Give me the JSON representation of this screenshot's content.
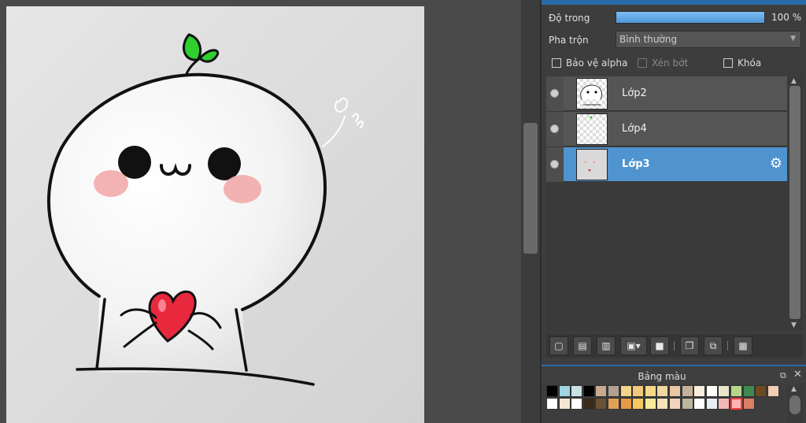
{
  "layer_props": {
    "opacity_label": "Độ trong",
    "opacity_value": "100 %",
    "opacity_level": 1.0,
    "blend_label": "Pha trộn",
    "blend_value": "Bình thường",
    "protect_alpha": "Bảo vệ alpha",
    "clipping": "Xén bớt",
    "lock": "Khóa"
  },
  "layers": [
    {
      "name": "Lớp2",
      "visible": true,
      "active": false
    },
    {
      "name": "Lớp4",
      "visible": true,
      "active": false
    },
    {
      "name": "Lớp3",
      "visible": true,
      "active": true
    }
  ],
  "palette": {
    "title": "Bảng màu",
    "selected_index": 18,
    "colors_row1": [
      "#000000",
      "#9fd3e0",
      "#c9e2e8",
      "#000000",
      "#c8ab8f",
      "#b0a190",
      "#f4d38a",
      "#f2c977",
      "#f5d888",
      "#f0d6a0",
      "#e9c6a4",
      "#c6b09a",
      "#f8eedd",
      "#ffffff",
      "#e8e6c9",
      "#b7d68c",
      "#3f8a50",
      "#6e4a1f",
      "#f1cdb4"
    ],
    "colors_row2": [
      "#ffffff",
      "#f4e6d4",
      "#ffffff",
      "#3a2a18",
      "#6b5235",
      "#e3a055",
      "#e9994a",
      "#f5c861",
      "#f7ea9a",
      "#f8e3b8",
      "#f3d4be",
      "#bdb59f",
      "#ffffff",
      "#e6eef3",
      "#f2b8b8",
      "#ffb2b2",
      "#d97f64"
    ]
  },
  "icons": {
    "settings": "gear-icon",
    "new_layer": "new-layer-icon",
    "new_8bit": "new-8bit-layer-icon",
    "new_1bit": "new-1bit-layer-icon",
    "add": "add-layer-menu-icon",
    "folder": "folder-icon",
    "duplicate": "duplicate-icon",
    "merge": "merge-icon",
    "delete": "trash-icon"
  },
  "colors": {
    "accent": "#4f93cf",
    "canvas_bg": "#d8d8d8",
    "heart": "#e8283c",
    "leaf": "#2fbf2f"
  }
}
